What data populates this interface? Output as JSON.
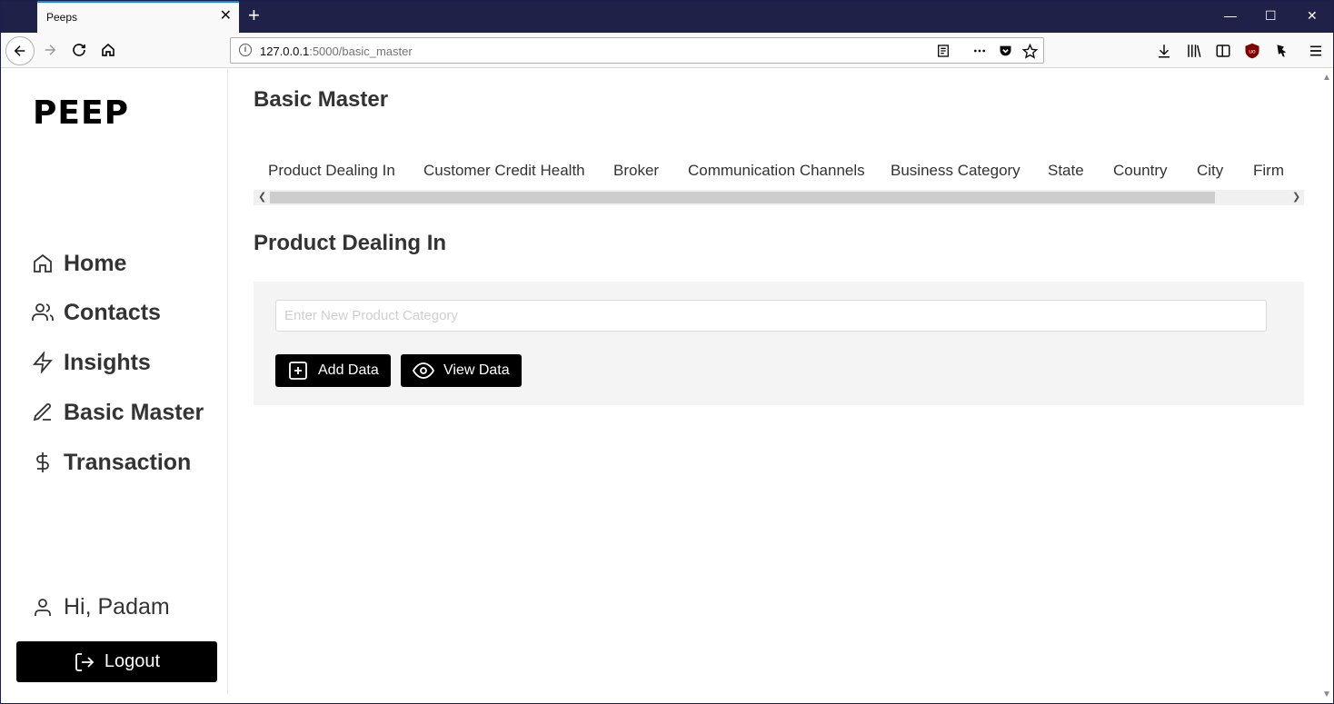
{
  "browser": {
    "tab_title": "Peeps",
    "tab_close": "✕",
    "new_tab": "+",
    "url_host": "127.0.0.1",
    "url_rest": ":5000/basic_master",
    "window_minimize": "—",
    "window_maximize": "☐",
    "window_close": "✕"
  },
  "sidebar": {
    "logo": "PEEP",
    "items": [
      {
        "label": "Home",
        "icon": "home-icon"
      },
      {
        "label": "Contacts",
        "icon": "users-icon"
      },
      {
        "label": "Insights",
        "icon": "zap-icon"
      },
      {
        "label": "Basic Master",
        "icon": "edit-icon"
      },
      {
        "label": "Transaction",
        "icon": "dollar-icon"
      }
    ],
    "greeting": "Hi, Padam",
    "logout_label": "Logout"
  },
  "main": {
    "title": "Basic Master",
    "tabs": [
      "Product Dealing In",
      "Customer Credit Health",
      "Broker",
      "Communication Channels",
      "Business Category",
      "State",
      "Country",
      "City",
      "Firm"
    ],
    "section_title": "Product Dealing In",
    "input_placeholder": "Enter New Product Category",
    "add_button": "Add Data",
    "view_button": "View Data"
  }
}
